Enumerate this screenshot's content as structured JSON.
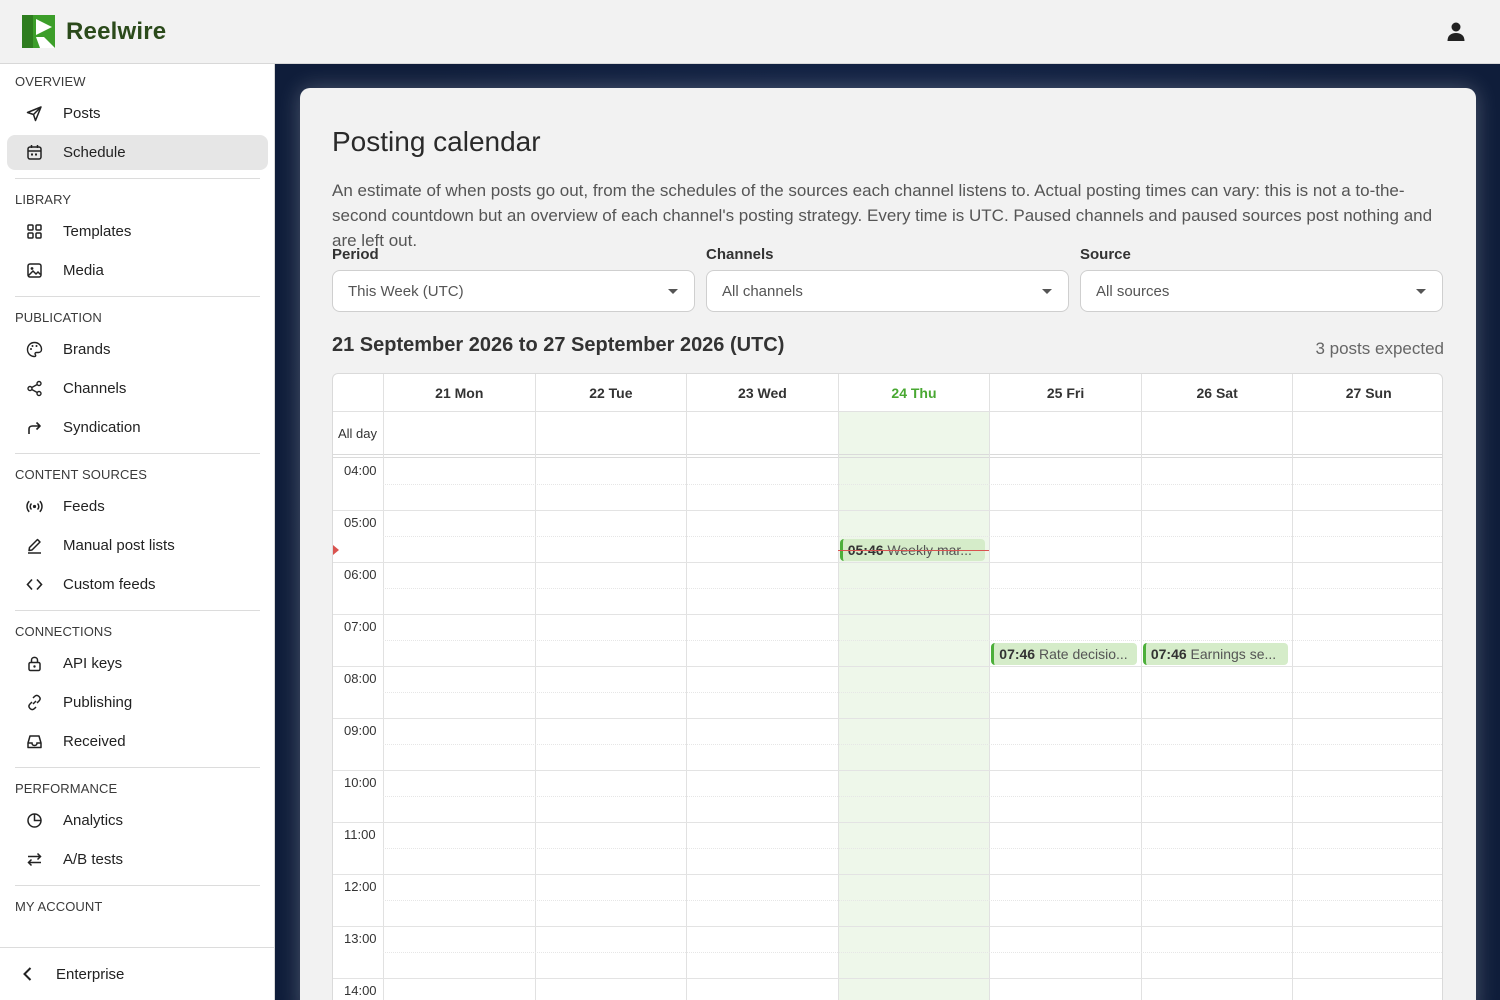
{
  "app": {
    "name": "Reelwire",
    "brand_color": "#3c9e2a"
  },
  "sidebar": {
    "sections": [
      {
        "heading": "OVERVIEW",
        "items": [
          {
            "label": "Posts",
            "icon": "send-icon"
          },
          {
            "label": "Schedule",
            "icon": "calendar-icon",
            "active": true
          }
        ]
      },
      {
        "heading": "LIBRARY",
        "items": [
          {
            "label": "Templates",
            "icon": "grid-icon"
          },
          {
            "label": "Media",
            "icon": "image-icon"
          }
        ]
      },
      {
        "heading": "PUBLICATION",
        "items": [
          {
            "label": "Brands",
            "icon": "palette-icon"
          },
          {
            "label": "Channels",
            "icon": "share-icon"
          },
          {
            "label": "Syndication",
            "icon": "forward-arrow-icon"
          }
        ]
      },
      {
        "heading": "CONTENT SOURCES",
        "items": [
          {
            "label": "Feeds",
            "icon": "broadcast-icon"
          },
          {
            "label": "Manual post lists",
            "icon": "pencil-icon"
          },
          {
            "label": "Custom feeds",
            "icon": "code-icon"
          }
        ]
      },
      {
        "heading": "CONNECTIONS",
        "items": [
          {
            "label": "API keys",
            "icon": "lock-icon"
          },
          {
            "label": "Publishing",
            "icon": "link-icon"
          },
          {
            "label": "Received",
            "icon": "inbox-icon"
          }
        ]
      },
      {
        "heading": "PERFORMANCE",
        "items": [
          {
            "label": "Analytics",
            "icon": "pie-chart-icon"
          },
          {
            "label": "A/B tests",
            "icon": "swap-icon"
          }
        ]
      },
      {
        "heading": "MY ACCOUNT",
        "items": []
      }
    ],
    "footer": {
      "label": "Enterprise",
      "icon": "chevron-left-icon"
    }
  },
  "page": {
    "title": "Posting calendar",
    "description": "An estimate of when posts go out, from the schedules of the sources each channel listens to. Actual posting times can vary: this is not a to-the-second countdown but an overview of each channel's posting strategy. Every time is UTC. Paused channels and paused sources post nothing and are left out.",
    "filters": {
      "period": {
        "label": "Period",
        "value": "This Week (UTC)"
      },
      "channels": {
        "label": "Channels",
        "value": "All channels"
      },
      "source": {
        "label": "Source",
        "value": "All sources"
      }
    },
    "range_title": "21 September 2026 to 27 September 2026 (UTC)",
    "expected": "3 posts expected"
  },
  "calendar": {
    "all_day_label": "All day",
    "days": [
      "21 Mon",
      "22 Tue",
      "23 Wed",
      "24 Thu",
      "25 Fri",
      "26 Sat",
      "27 Sun"
    ],
    "today_index": 3,
    "hours": [
      "04:00",
      "05:00",
      "06:00",
      "07:00",
      "08:00",
      "09:00",
      "10:00",
      "11:00",
      "12:00",
      "13:00",
      "14:00"
    ],
    "events": [
      {
        "day": 3,
        "time": "05:46",
        "title": "Weekly mar...",
        "past": true
      },
      {
        "day": 4,
        "time": "07:46",
        "title": "Rate decisio..."
      },
      {
        "day": 5,
        "time": "07:46",
        "title": "Earnings se..."
      }
    ]
  }
}
